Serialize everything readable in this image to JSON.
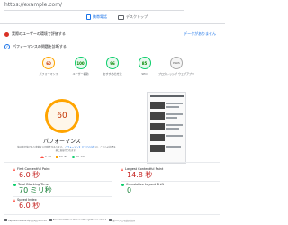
{
  "url": "https://example.com/",
  "tabs": [
    {
      "label": "携帯電話",
      "active": true
    },
    {
      "label": "デスクトップ",
      "active": false
    }
  ],
  "crux": {
    "title": "実際のユーザーの環境で評価する",
    "link": "データがありません"
  },
  "diagnose": {
    "title": "パフォーマンスの問題を診断する"
  },
  "scores": [
    {
      "value": "60",
      "label": "パフォーマンス",
      "style": "orange"
    },
    {
      "value": "100",
      "label": "ユーザー補助",
      "style": "green"
    },
    {
      "value": "96",
      "label": "おすすめの方法",
      "style": "green"
    },
    {
      "value": "85",
      "label": "SEO",
      "style": "green"
    },
    {
      "value": "PWA",
      "label": "プログレッシブ ウェブアプリ",
      "style": "pwa"
    }
  ],
  "performance": {
    "score": "60",
    "title": "パフォーマンス",
    "description": "値は推定値であり変動する可能性があります。",
    "description_link": "パフォーマンス スコアの計算",
    "description_tail": "は、これらの指標を基に直接行われます。",
    "legend": [
      {
        "shape": "triangle",
        "label": "0–49"
      },
      {
        "shape": "square",
        "label": "50–89"
      },
      {
        "shape": "circle",
        "label": "90–100"
      }
    ]
  },
  "metrics": [
    {
      "name": "First Contentful Paint",
      "value": "6.0 秒",
      "status": "poor"
    },
    {
      "name": "Largest Contentful Paint",
      "value": "14.8 秒",
      "status": "poor"
    },
    {
      "name": "Total Blocking Time",
      "value": "70 ミリ秒",
      "status": "good"
    },
    {
      "name": "Cumulative Layout Shift",
      "value": "0",
      "status": "good"
    },
    {
      "name": "Speed Index",
      "value": "6.0 秒",
      "status": "poor"
    }
  ],
  "footer": [
    "Captured at 2023年4月1日 GMT+9",
    "Emulated Moto G Power with Lighthouse 10.0.2",
    "単一ページの読み込み",
    "Initial page load",
    "Slow 4G スロットリング",
    "Using HeadlessChromium 111.0.5563.146 with lr"
  ]
}
